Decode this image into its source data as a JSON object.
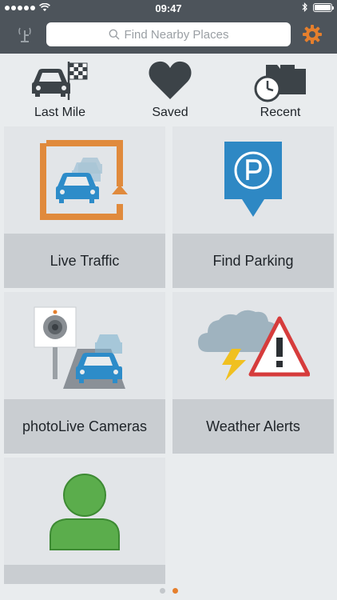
{
  "status_bar": {
    "time": "09:47",
    "signal_dots": 5,
    "icons": [
      "wifi-icon",
      "bluetooth-icon",
      "battery-icon"
    ]
  },
  "top_bar": {
    "left_icon": "antenna-icon",
    "search_placeholder": "Find Nearby Places",
    "settings_icon": "gear-icon",
    "colors": {
      "background": "#4d545b",
      "accent": "#e57f2d"
    }
  },
  "quick_access": [
    {
      "label": "Last Mile",
      "icon": "car-finish-flag-icon"
    },
    {
      "label": "Saved",
      "icon": "heart-icon"
    },
    {
      "label": "Recent",
      "icon": "folder-clock-icon"
    }
  ],
  "tiles": [
    {
      "label": "Live Traffic",
      "icon": "traffic-cars-icon"
    },
    {
      "label": "Find Parking",
      "icon": "parking-pin-icon"
    },
    {
      "label": "photoLive Cameras",
      "icon": "traffic-camera-icon"
    },
    {
      "label": "Weather Alerts",
      "icon": "storm-warning-icon"
    },
    {
      "label": "",
      "icon": "user-profile-icon"
    }
  ],
  "pagination": {
    "pages": 2,
    "active_index": 1
  }
}
